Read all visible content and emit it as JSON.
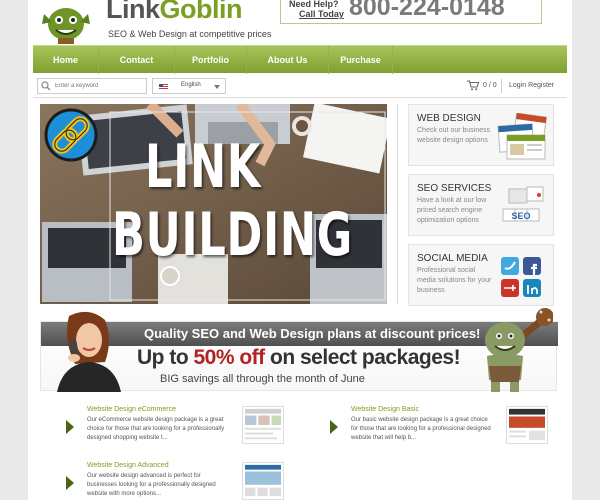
{
  "brand": {
    "logo_part1": "Link",
    "logo_part2": "Goblin",
    "tagline": "SEO & Web Design at competitive prices"
  },
  "contact": {
    "need_help": "Need Help?",
    "call_today": "Call Today",
    "phone": "800-224-0148"
  },
  "nav": {
    "items": [
      {
        "label": "Home"
      },
      {
        "label": "Contact"
      },
      {
        "label": "Portfolio"
      },
      {
        "label": "About Us"
      },
      {
        "label": "Purchase"
      }
    ]
  },
  "utility": {
    "search_placeholder": "Enter a keyword",
    "language": "English",
    "cart_count": "0 / 0",
    "login_register": "Login Register"
  },
  "hero": {
    "line1": "LINK",
    "line2": "BUILDING"
  },
  "services": [
    {
      "title": "WEB DESIGN",
      "text": "Check out our business website design options"
    },
    {
      "title": "SEO SERVICES",
      "text": "Have a look at our low priced search engine optimization options"
    },
    {
      "title": "SOCIAL MEDIA",
      "text": "Professional social media solutions for your business"
    }
  ],
  "seo_tag": "SEO",
  "banner": {
    "headline": "Quality SEO and Web Design plans at discount prices!",
    "big_prefix": "Up to ",
    "big_pct": "50% off",
    "big_suffix": " on select packages!",
    "sub": "BIG savings all through the month of June"
  },
  "packages": [
    {
      "title": "Website Design eCommerce",
      "desc": "Our eCommerce website design package is a great choice for those that are looking for a professionally designed shopping website t..."
    },
    {
      "title": "Website Design Basic",
      "desc": "Our basic website design package is a great choice for those that are looking for a professional designed website that will help b..."
    },
    {
      "title": "Website Design Advanced",
      "desc": "Our website design advanced is perfect for businesses looking for a professionally designed website with more options..."
    }
  ],
  "colors": {
    "brand_green": "#7aa022",
    "nav_green": "#8fb03f",
    "accent_red": "#b12323",
    "banner_gray": "#5f5f5f"
  }
}
